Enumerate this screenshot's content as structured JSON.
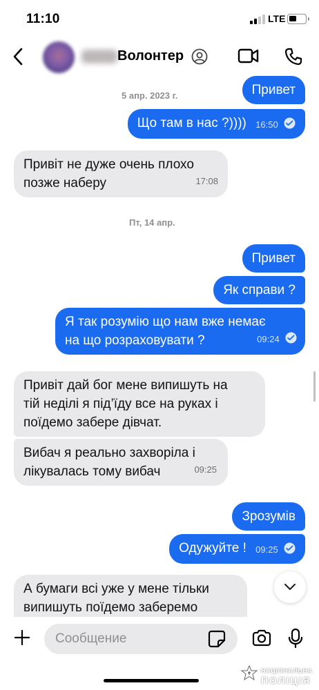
{
  "status_bar": {
    "time": "11:10",
    "network": "LTE"
  },
  "header": {
    "contact_name": "Волонтер",
    "icons": {
      "back": "chevron-left-icon",
      "profile": "person-circle-icon",
      "video": "video-camera-icon",
      "call": "phone-icon"
    }
  },
  "chat": {
    "dates": [
      "5 апр. 2023 г.",
      "Пт, 14 апр."
    ],
    "messages": [
      {
        "direction": "out",
        "text": "Привет",
        "time": ""
      },
      {
        "direction": "out",
        "text": "Що там в нас ?))))",
        "time": "16:50"
      },
      {
        "direction": "in",
        "lines": [
          "Привіт не дуже очень плохо",
          "позже наберу"
        ],
        "time": "17:08"
      },
      {
        "direction": "out",
        "text": "Привет",
        "time": ""
      },
      {
        "direction": "out",
        "text": "Як справи ?",
        "time": ""
      },
      {
        "direction": "out",
        "lines": [
          "Я так розумію що нам вже немає",
          "на що розраховувати ?"
        ],
        "time": "09:24"
      },
      {
        "direction": "in",
        "lines": [
          "Привіт дай бог мене випишуть на",
          "тій неділі я під’їду все на руках і",
          "поїдемо забере дівчат."
        ],
        "time": ""
      },
      {
        "direction": "in",
        "lines": [
          "Вибач я реально захворіла і",
          "лікувалась тому вибач"
        ],
        "time": "09:25"
      },
      {
        "direction": "out",
        "text": "Зрозумів",
        "time": ""
      },
      {
        "direction": "out",
        "text": "Одужуйте !",
        "time": "09:25"
      },
      {
        "direction": "in",
        "lines": [
          "А бумаги всі уже у мене тільки",
          "випишуть поїдемо заберемо"
        ],
        "time": ""
      }
    ]
  },
  "composer": {
    "placeholder": "Сообщение"
  },
  "watermark": {
    "line1": "НАЦІОНАЛЬНА",
    "line2": "ПОЛІЦІЯ"
  },
  "colors": {
    "outgoing_bubble": "#1a6bf0",
    "incoming_bubble": "#e9e9eb",
    "accent": "#1a6bf0"
  }
}
